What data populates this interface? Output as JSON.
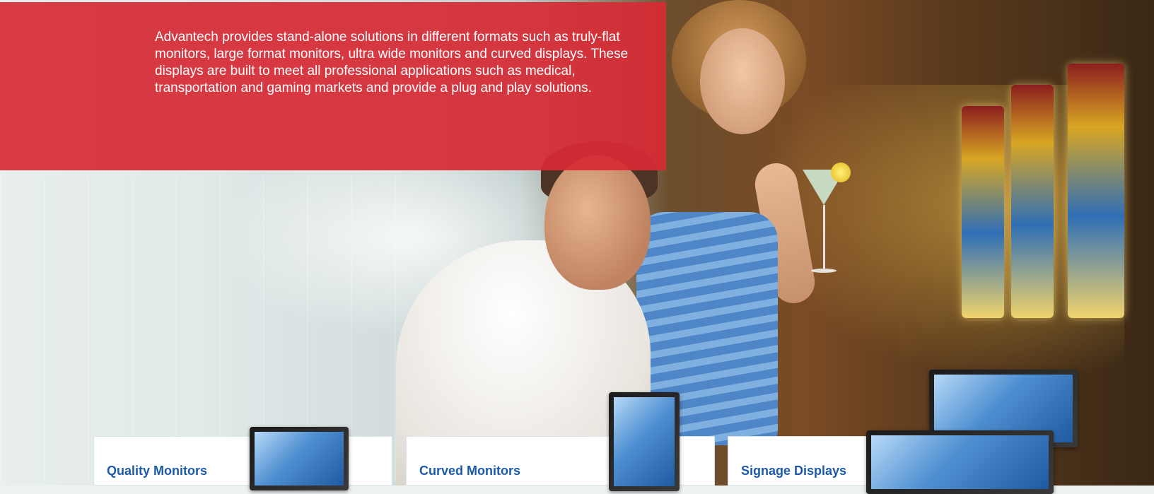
{
  "banner": {
    "text": "Advantech provides stand-alone solutions in different formats such as truly-flat monitors, large format monitors, ultra wide monitors and curved displays. These displays are built to meet all professional applications such as medical, transportation and gaming markets and provide a plug and play solutions."
  },
  "cards": [
    {
      "title": "Quality Monitors"
    },
    {
      "title": "Curved Monitors"
    },
    {
      "title": "Signage Displays"
    }
  ],
  "colors": {
    "banner": "#d62b35",
    "card_title": "#1d5aa8"
  }
}
